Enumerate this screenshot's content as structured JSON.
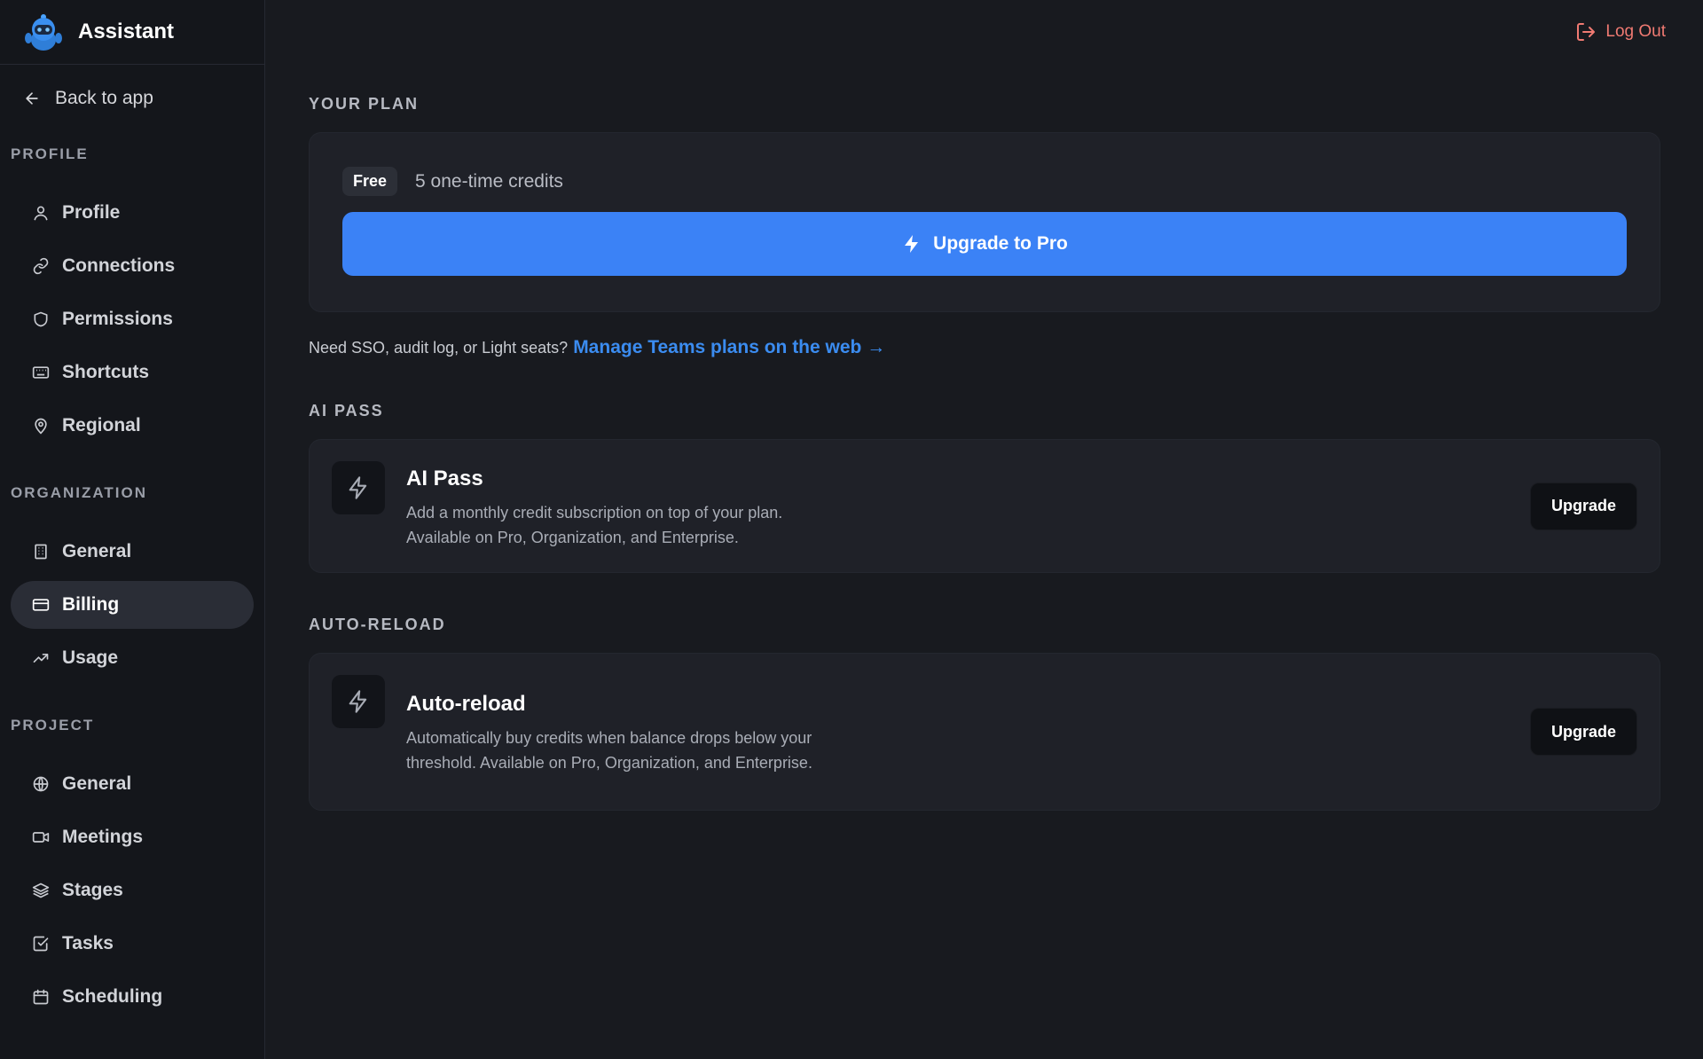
{
  "brand": {
    "name": "Assistant"
  },
  "sidebar": {
    "back_label": "Back to app",
    "sections": [
      {
        "title": "PROFILE",
        "items": [
          {
            "label": "Profile",
            "icon": "user-icon"
          },
          {
            "label": "Connections",
            "icon": "link-icon"
          },
          {
            "label": "Permissions",
            "icon": "shield-icon"
          },
          {
            "label": "Shortcuts",
            "icon": "keyboard-icon"
          },
          {
            "label": "Regional",
            "icon": "map-pin-icon"
          }
        ]
      },
      {
        "title": "ORGANIZATION",
        "items": [
          {
            "label": "General",
            "icon": "building-icon"
          },
          {
            "label": "Billing",
            "icon": "credit-card-icon",
            "active": true
          },
          {
            "label": "Usage",
            "icon": "trending-up-icon"
          }
        ]
      },
      {
        "title": "PROJECT",
        "items": [
          {
            "label": "General",
            "icon": "globe-icon"
          },
          {
            "label": "Meetings",
            "icon": "video-icon"
          },
          {
            "label": "Stages",
            "icon": "layers-icon"
          },
          {
            "label": "Tasks",
            "icon": "check-square-icon"
          },
          {
            "label": "Scheduling",
            "icon": "calendar-icon"
          }
        ]
      }
    ]
  },
  "header": {
    "logout_label": "Log Out"
  },
  "plan": {
    "section_title": "YOUR PLAN",
    "badge": "Free",
    "credits": "5 one-time credits",
    "upgrade_label": "Upgrade to Pro",
    "teams_prompt": "Need SSO, audit log, or Light seats?",
    "teams_link": "Manage Teams plans on the web →"
  },
  "ai_pass": {
    "section_title": "AI PASS",
    "title": "AI Pass",
    "description": "Add a monthly credit subscription on top of your plan. Available on Pro, Organization, and Enterprise.",
    "button": "Upgrade"
  },
  "auto_reload": {
    "section_title": "AUTO-RELOAD",
    "title": "Auto-reload",
    "description": "Automatically buy credits when balance drops below your threshold. Available on Pro, Organization, and Enterprise.",
    "button": "Upgrade"
  },
  "colors": {
    "accent": "#3b82f6",
    "logout": "#f07a72",
    "link": "#3b8cf0"
  }
}
